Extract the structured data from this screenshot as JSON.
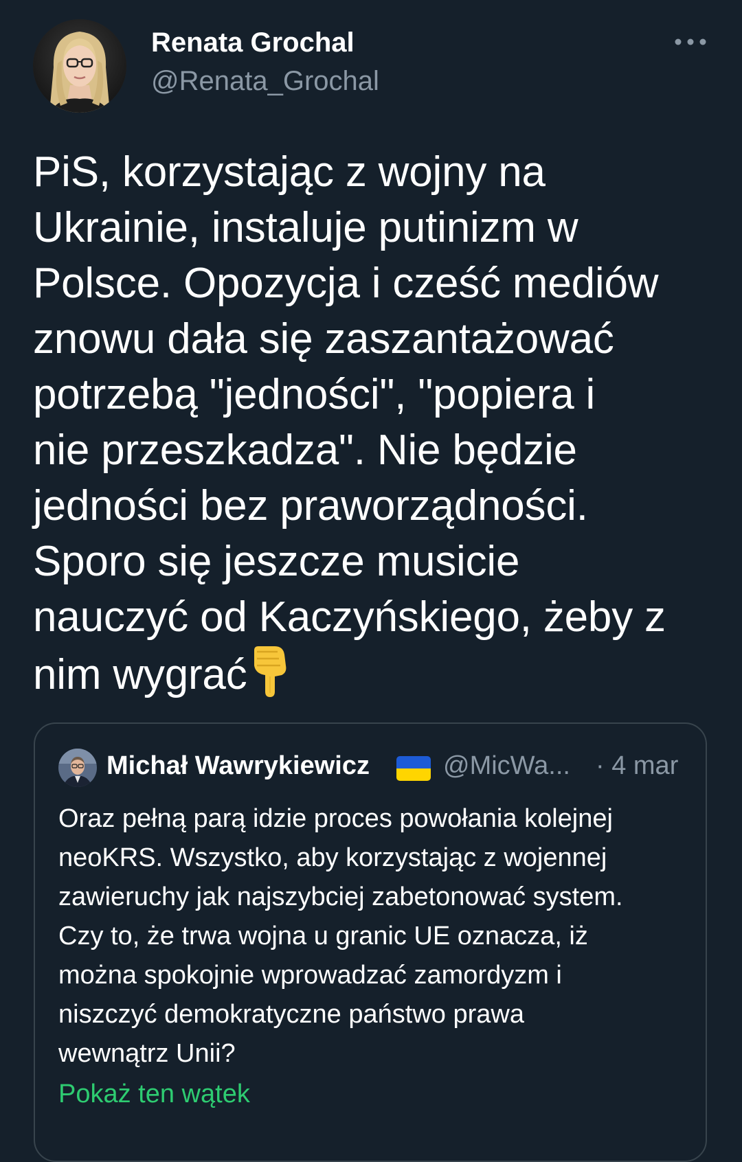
{
  "tweet": {
    "author": {
      "name": "Renata Grochal",
      "handle": "@Renata_Grochal",
      "avatar_icon": "profile-photo-woman-glasses"
    },
    "more_icon": "more-horizontal-icon",
    "text": "PiS, korzystając z wojny na\nUkrainie, instaluje putinizm w\nPolsce. Opozycja i cześć mediów\nznowu dała się zaszantażować\npotrzebą \"jedności\", \"popiera i\nnie przeszkadza\". Nie będzie\njedności bez praworządności.\nSporo się jeszcze musicie\nnauczyć od Kaczyńskiego, żeby z\nnim wygrać",
    "emoji": "backhand-index-pointing-down-emoji"
  },
  "quoted": {
    "author": {
      "name": "Michał Wawrykiewicz",
      "handle": "@MicWa...",
      "flag": "ukraine-flag",
      "avatar_icon": "profile-photo-man"
    },
    "date": "· 4 mar",
    "text": "Oraz pełną parą idzie proces powołania kolejnej\nneoKRS. Wszystko, aby korzystając z wojennej\nzawieruchy jak najszybciej zabetonować system.\nCzy to, że trwa wojna u granic UE oznacza, iż\nmożna spokojnie wprowadzać zamordyzm i\nniszczyć demokratyczne państwo prawa\nwewnątrz Unii?",
    "show_thread_label": "Pokaż ten wątek"
  },
  "colors": {
    "background": "#15202b",
    "text": "#ffffff",
    "secondary_text": "#8b98a5",
    "border": "#38444d",
    "link": "#2ecc71"
  }
}
